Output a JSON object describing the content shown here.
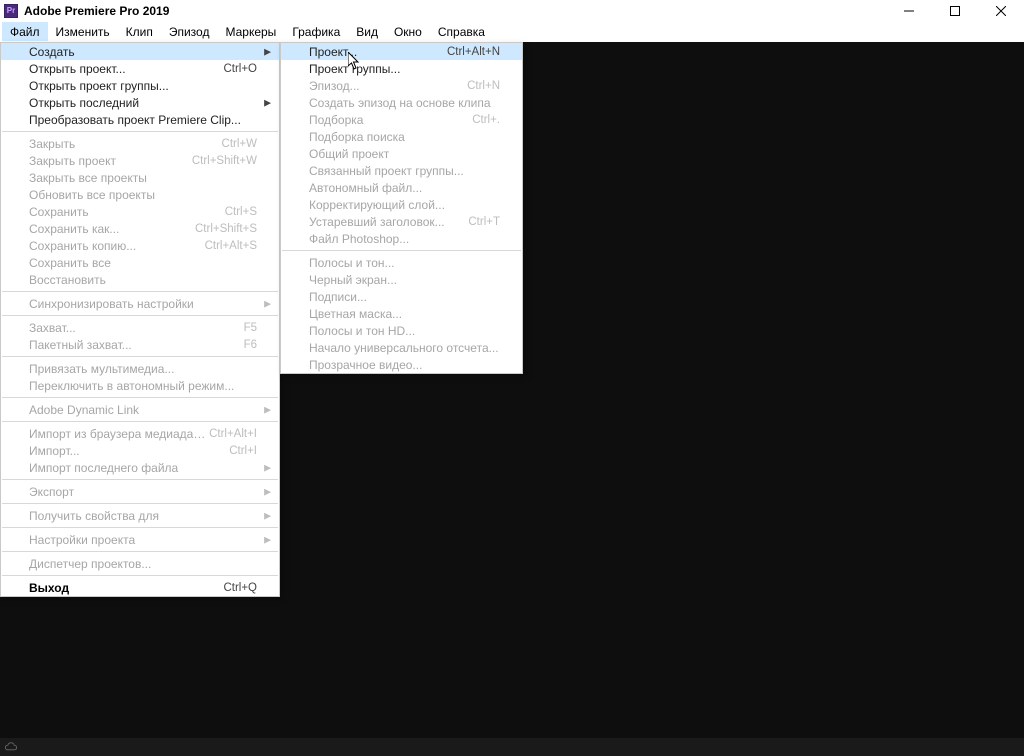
{
  "title": "Adobe Premiere Pro 2019",
  "app_icon_text": "Pr",
  "menubar": {
    "items": [
      "Файл",
      "Изменить",
      "Клип",
      "Эпизод",
      "Маркеры",
      "Графика",
      "Вид",
      "Окно",
      "Справка"
    ],
    "active_index": 0
  },
  "file_menu": {
    "groups": [
      [
        {
          "label": "Создать",
          "shortcut": "",
          "disabled": false,
          "submenu": true,
          "hover": true,
          "bold": false
        },
        {
          "label": "Открыть проект...",
          "shortcut": "Ctrl+O",
          "disabled": false,
          "submenu": false,
          "hover": false,
          "bold": false
        },
        {
          "label": "Открыть проект группы...",
          "shortcut": "",
          "disabled": false,
          "submenu": false,
          "hover": false,
          "bold": false
        },
        {
          "label": "Открыть последний",
          "shortcut": "",
          "disabled": false,
          "submenu": true,
          "hover": false,
          "bold": false
        },
        {
          "label": "Преобразовать проект Premiere Clip...",
          "shortcut": "",
          "disabled": false,
          "submenu": false,
          "hover": false,
          "bold": false
        }
      ],
      [
        {
          "label": "Закрыть",
          "shortcut": "Ctrl+W",
          "disabled": true,
          "submenu": false,
          "hover": false,
          "bold": false
        },
        {
          "label": "Закрыть проект",
          "shortcut": "Ctrl+Shift+W",
          "disabled": true,
          "submenu": false,
          "hover": false,
          "bold": false
        },
        {
          "label": "Закрыть все проекты",
          "shortcut": "",
          "disabled": true,
          "submenu": false,
          "hover": false,
          "bold": false
        },
        {
          "label": "Обновить все проекты",
          "shortcut": "",
          "disabled": true,
          "submenu": false,
          "hover": false,
          "bold": false
        },
        {
          "label": "Сохранить",
          "shortcut": "Ctrl+S",
          "disabled": true,
          "submenu": false,
          "hover": false,
          "bold": false
        },
        {
          "label": "Сохранить как...",
          "shortcut": "Ctrl+Shift+S",
          "disabled": true,
          "submenu": false,
          "hover": false,
          "bold": false
        },
        {
          "label": "Сохранить копию...",
          "shortcut": "Ctrl+Alt+S",
          "disabled": true,
          "submenu": false,
          "hover": false,
          "bold": false
        },
        {
          "label": "Сохранить все",
          "shortcut": "",
          "disabled": true,
          "submenu": false,
          "hover": false,
          "bold": false
        },
        {
          "label": "Восстановить",
          "shortcut": "",
          "disabled": true,
          "submenu": false,
          "hover": false,
          "bold": false
        }
      ],
      [
        {
          "label": "Синхронизировать настройки",
          "shortcut": "",
          "disabled": true,
          "submenu": true,
          "hover": false,
          "bold": false
        }
      ],
      [
        {
          "label": "Захват...",
          "shortcut": "F5",
          "disabled": true,
          "submenu": false,
          "hover": false,
          "bold": false
        },
        {
          "label": "Пакетный захват...",
          "shortcut": "F6",
          "disabled": true,
          "submenu": false,
          "hover": false,
          "bold": false
        }
      ],
      [
        {
          "label": "Привязать мультимедиа...",
          "shortcut": "",
          "disabled": true,
          "submenu": false,
          "hover": false,
          "bold": false
        },
        {
          "label": "Переключить в автономный режим...",
          "shortcut": "",
          "disabled": true,
          "submenu": false,
          "hover": false,
          "bold": false
        }
      ],
      [
        {
          "label": "Adobe Dynamic Link",
          "shortcut": "",
          "disabled": true,
          "submenu": true,
          "hover": false,
          "bold": false
        }
      ],
      [
        {
          "label": "Импорт из браузера медиаданных",
          "shortcut": "Ctrl+Alt+I",
          "disabled": true,
          "submenu": false,
          "hover": false,
          "bold": false
        },
        {
          "label": "Импорт...",
          "shortcut": "Ctrl+I",
          "disabled": true,
          "submenu": false,
          "hover": false,
          "bold": false
        },
        {
          "label": "Импорт последнего файла",
          "shortcut": "",
          "disabled": true,
          "submenu": true,
          "hover": false,
          "bold": false
        }
      ],
      [
        {
          "label": "Экспорт",
          "shortcut": "",
          "disabled": true,
          "submenu": true,
          "hover": false,
          "bold": false
        }
      ],
      [
        {
          "label": "Получить свойства для",
          "shortcut": "",
          "disabled": true,
          "submenu": true,
          "hover": false,
          "bold": false
        }
      ],
      [
        {
          "label": "Настройки проекта",
          "shortcut": "",
          "disabled": true,
          "submenu": true,
          "hover": false,
          "bold": false
        }
      ],
      [
        {
          "label": "Диспетчер проектов...",
          "shortcut": "",
          "disabled": true,
          "submenu": false,
          "hover": false,
          "bold": false
        }
      ],
      [
        {
          "label": "Выход",
          "shortcut": "Ctrl+Q",
          "disabled": false,
          "submenu": false,
          "hover": false,
          "bold": true
        }
      ]
    ]
  },
  "create_submenu": {
    "groups": [
      [
        {
          "label": "Проект...",
          "shortcut": "Ctrl+Alt+N",
          "disabled": false,
          "submenu": false,
          "hover": true,
          "bold": false
        },
        {
          "label": "Проект группы...",
          "shortcut": "",
          "disabled": false,
          "submenu": false,
          "hover": false,
          "bold": false
        },
        {
          "label": "Эпизод...",
          "shortcut": "Ctrl+N",
          "disabled": true,
          "submenu": false,
          "hover": false,
          "bold": false
        },
        {
          "label": "Создать эпизод на основе клипа",
          "shortcut": "",
          "disabled": true,
          "submenu": false,
          "hover": false,
          "bold": false
        },
        {
          "label": "Подборка",
          "shortcut": "Ctrl+.",
          "disabled": true,
          "submenu": false,
          "hover": false,
          "bold": false
        },
        {
          "label": "Подборка поиска",
          "shortcut": "",
          "disabled": true,
          "submenu": false,
          "hover": false,
          "bold": false
        },
        {
          "label": "Общий проект",
          "shortcut": "",
          "disabled": true,
          "submenu": false,
          "hover": false,
          "bold": false
        },
        {
          "label": "Связанный проект группы...",
          "shortcut": "",
          "disabled": true,
          "submenu": false,
          "hover": false,
          "bold": false
        },
        {
          "label": "Автономный файл...",
          "shortcut": "",
          "disabled": true,
          "submenu": false,
          "hover": false,
          "bold": false
        },
        {
          "label": "Корректирующий слой...",
          "shortcut": "",
          "disabled": true,
          "submenu": false,
          "hover": false,
          "bold": false
        },
        {
          "label": "Устаревший заголовок...",
          "shortcut": "Ctrl+T",
          "disabled": true,
          "submenu": false,
          "hover": false,
          "bold": false
        },
        {
          "label": "Файл Photoshop...",
          "shortcut": "",
          "disabled": true,
          "submenu": false,
          "hover": false,
          "bold": false
        }
      ],
      [
        {
          "label": "Полосы и тон...",
          "shortcut": "",
          "disabled": true,
          "submenu": false,
          "hover": false,
          "bold": false
        },
        {
          "label": "Черный экран...",
          "shortcut": "",
          "disabled": true,
          "submenu": false,
          "hover": false,
          "bold": false
        },
        {
          "label": "Подписи...",
          "shortcut": "",
          "disabled": true,
          "submenu": false,
          "hover": false,
          "bold": false
        },
        {
          "label": "Цветная маска...",
          "shortcut": "",
          "disabled": true,
          "submenu": false,
          "hover": false,
          "bold": false
        },
        {
          "label": "Полосы и тон HD...",
          "shortcut": "",
          "disabled": true,
          "submenu": false,
          "hover": false,
          "bold": false
        },
        {
          "label": "Начало универсального отсчета...",
          "shortcut": "",
          "disabled": true,
          "submenu": false,
          "hover": false,
          "bold": false
        },
        {
          "label": "Прозрачное видео...",
          "shortcut": "",
          "disabled": true,
          "submenu": false,
          "hover": false,
          "bold": false
        }
      ]
    ]
  }
}
